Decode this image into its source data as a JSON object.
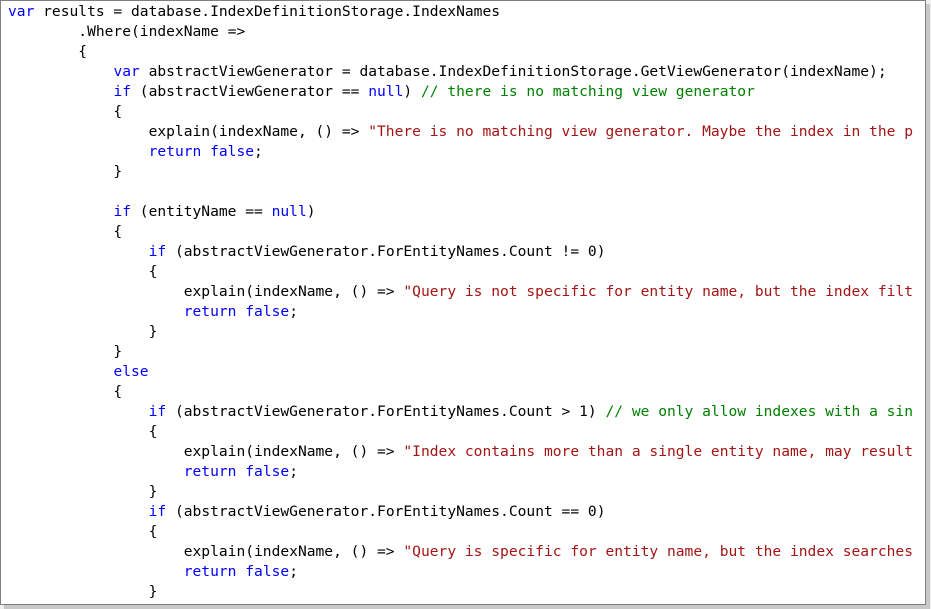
{
  "editor": {
    "colors": {
      "keyword": "#0000ff",
      "string": "#a31515",
      "comment": "#008000",
      "plain": "#000000",
      "background": "#ffffff"
    },
    "lines": [
      [
        [
          "k",
          "var"
        ],
        [
          "p",
          " results = database.IndexDefinitionStorage.IndexNames"
        ]
      ],
      [
        [
          "p",
          "        .Where(indexName =>"
        ]
      ],
      [
        [
          "p",
          "        {"
        ]
      ],
      [
        [
          "p",
          "            "
        ],
        [
          "k",
          "var"
        ],
        [
          "p",
          " abstractViewGenerator = database.IndexDefinitionStorage.GetViewGenerator(indexName);"
        ]
      ],
      [
        [
          "p",
          "            "
        ],
        [
          "k",
          "if"
        ],
        [
          "p",
          " (abstractViewGenerator == "
        ],
        [
          "k",
          "null"
        ],
        [
          "p",
          ") "
        ],
        [
          "c",
          "// there is no matching view generator"
        ]
      ],
      [
        [
          "p",
          "            {"
        ]
      ],
      [
        [
          "p",
          "                explain(indexName, () => "
        ],
        [
          "s",
          "\"There is no matching view generator. Maybe the index in the p"
        ]
      ],
      [
        [
          "p",
          "                "
        ],
        [
          "k",
          "return"
        ],
        [
          "p",
          " "
        ],
        [
          "k",
          "false"
        ],
        [
          "p",
          ";"
        ]
      ],
      [
        [
          "p",
          "            }"
        ]
      ],
      [
        [
          "p",
          ""
        ]
      ],
      [
        [
          "p",
          "            "
        ],
        [
          "k",
          "if"
        ],
        [
          "p",
          " (entityName == "
        ],
        [
          "k",
          "null"
        ],
        [
          "p",
          ")"
        ]
      ],
      [
        [
          "p",
          "            {"
        ]
      ],
      [
        [
          "p",
          "                "
        ],
        [
          "k",
          "if"
        ],
        [
          "p",
          " (abstractViewGenerator.ForEntityNames.Count != 0)"
        ]
      ],
      [
        [
          "p",
          "                {"
        ]
      ],
      [
        [
          "p",
          "                    explain(indexName, () => "
        ],
        [
          "s",
          "\"Query is not specific for entity name, but the index filt"
        ]
      ],
      [
        [
          "p",
          "                    "
        ],
        [
          "k",
          "return"
        ],
        [
          "p",
          " "
        ],
        [
          "k",
          "false"
        ],
        [
          "p",
          ";"
        ]
      ],
      [
        [
          "p",
          "                }"
        ]
      ],
      [
        [
          "p",
          "            }"
        ]
      ],
      [
        [
          "p",
          "            "
        ],
        [
          "k",
          "else"
        ]
      ],
      [
        [
          "p",
          "            {"
        ]
      ],
      [
        [
          "p",
          "                "
        ],
        [
          "k",
          "if"
        ],
        [
          "p",
          " (abstractViewGenerator.ForEntityNames.Count > 1) "
        ],
        [
          "c",
          "// we only allow indexes with a sin"
        ]
      ],
      [
        [
          "p",
          "                {"
        ]
      ],
      [
        [
          "p",
          "                    explain(indexName, () => "
        ],
        [
          "s",
          "\"Index contains more than a single entity name, may result"
        ]
      ],
      [
        [
          "p",
          "                    "
        ],
        [
          "k",
          "return"
        ],
        [
          "p",
          " "
        ],
        [
          "k",
          "false"
        ],
        [
          "p",
          ";"
        ]
      ],
      [
        [
          "p",
          "                }"
        ]
      ],
      [
        [
          "p",
          "                "
        ],
        [
          "k",
          "if"
        ],
        [
          "p",
          " (abstractViewGenerator.ForEntityNames.Count == 0)"
        ]
      ],
      [
        [
          "p",
          "                {"
        ]
      ],
      [
        [
          "p",
          "                    explain(indexName, () => "
        ],
        [
          "s",
          "\"Query is specific for entity name, but the index searches"
        ]
      ],
      [
        [
          "p",
          "                    "
        ],
        [
          "k",
          "return"
        ],
        [
          "p",
          " "
        ],
        [
          "k",
          "false"
        ],
        [
          "p",
          ";"
        ]
      ],
      [
        [
          "p",
          "                }"
        ]
      ]
    ]
  }
}
